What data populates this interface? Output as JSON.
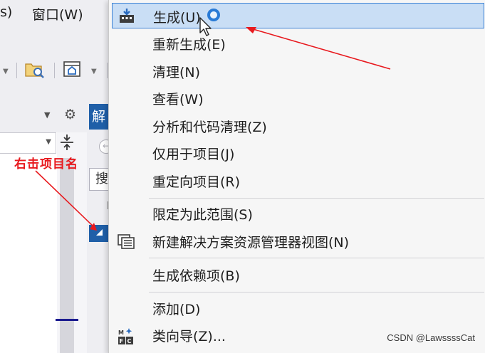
{
  "background": {
    "paren_fragment": "s)",
    "window_menu": "窗口(W)",
    "solution_tab": "解",
    "search_char": "搜",
    "tree_item_char": "l"
  },
  "annotation": {
    "label": "右击项目名",
    "color": "#e8191e"
  },
  "context_menu": {
    "items": [
      {
        "label": "生成(U)",
        "icon": "build-icon",
        "highlighted": true
      },
      {
        "label": "重新生成(E)"
      },
      {
        "label": "清理(N)"
      },
      {
        "label": "查看(W)"
      },
      {
        "label": "分析和代码清理(Z)"
      },
      {
        "label": "仅用于项目(J)"
      },
      {
        "label": "重定向项目(R)"
      },
      {
        "label": "限定为此范围(S)"
      },
      {
        "label": "新建解决方案资源管理器视图(N)",
        "icon": "new-view-icon"
      },
      {
        "label": "生成依赖项(B)"
      },
      {
        "label": "添加(D)"
      },
      {
        "label": "类向导(Z)...",
        "icon": "mfc-class-wizard-icon"
      }
    ]
  },
  "colors": {
    "highlight_bg": "#c9def5",
    "highlight_border": "#3e84d6",
    "accent_blue": "#1f5fa8"
  },
  "watermark": "CSDN @LawssssCat"
}
